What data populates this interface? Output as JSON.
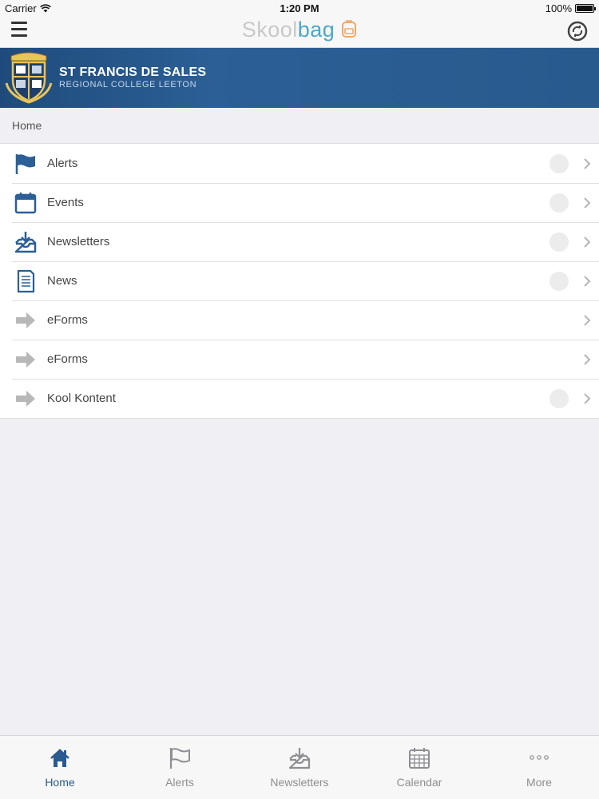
{
  "status_bar": {
    "carrier": "Carrier",
    "time": "1:20 PM",
    "battery": "100%"
  },
  "nav": {
    "logo_part1": "Skool",
    "logo_part2": "bag",
    "menu_icon": "hamburger-icon",
    "sync_icon": "sync-icon"
  },
  "banner": {
    "title": "ST FRANCIS DE SALES",
    "subtitle": "REGIONAL COLLEGE LEETON",
    "crest_text": "ST FRANCIS"
  },
  "breadcrumb": "Home",
  "menu": {
    "items": [
      {
        "label": "Alerts",
        "icon": "flag-icon",
        "badge": true
      },
      {
        "label": "Events",
        "icon": "calendar-icon",
        "badge": true
      },
      {
        "label": "Newsletters",
        "icon": "inbox-download-icon",
        "badge": true
      },
      {
        "label": "News",
        "icon": "document-icon",
        "badge": true
      },
      {
        "label": "eForms",
        "icon": "arrow-right-icon",
        "badge": false
      },
      {
        "label": "eForms",
        "icon": "arrow-right-icon",
        "badge": false
      },
      {
        "label": "Kool Kontent",
        "icon": "arrow-right-icon",
        "badge": true
      }
    ]
  },
  "tabs": [
    {
      "label": "Home",
      "icon": "home-icon",
      "active": true
    },
    {
      "label": "Alerts",
      "icon": "flag-icon",
      "active": false
    },
    {
      "label": "Newsletters",
      "icon": "inbox-download-icon",
      "active": false
    },
    {
      "label": "Calendar",
      "icon": "calendar-grid-icon",
      "active": false
    },
    {
      "label": "More",
      "icon": "more-dots-icon",
      "active": false
    }
  ],
  "colors": {
    "brand_blue": "#2b5f95",
    "active_tab": "#2a5a8e",
    "logo_accent": "#4aa8c8"
  }
}
